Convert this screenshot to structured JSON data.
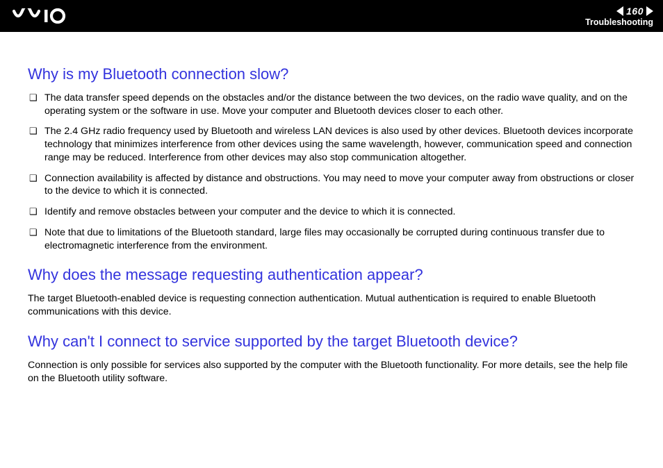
{
  "header": {
    "page_number": "160",
    "section": "Troubleshooting"
  },
  "q1": {
    "title": "Why is my Bluetooth connection slow?",
    "bullets": [
      "The data transfer speed depends on the obstacles and/or the distance between the two devices, on the radio wave quality, and on the operating system or the software in use. Move your computer and Bluetooth devices closer to each other.",
      "The 2.4 GHz radio frequency used by Bluetooth and wireless LAN devices is also used by other devices. Bluetooth devices incorporate technology that minimizes interference from other devices using the same wavelength, however, communication speed and connection range may be reduced. Interference from other devices may also stop communication altogether.",
      "Connection availability is affected by distance and obstructions. You may need to move your computer away from obstructions or closer to the device to which it is connected.",
      "Identify and remove obstacles between your computer and the device to which it is connected.",
      "Note that due to limitations of the Bluetooth standard, large files may occasionally be corrupted during continuous transfer due to electromagnetic interference from the environment."
    ]
  },
  "q2": {
    "title": "Why does the message requesting authentication appear?",
    "body": "The target Bluetooth-enabled device is requesting connection authentication. Mutual authentication is required to enable Bluetooth communications with this device."
  },
  "q3": {
    "title": "Why can't I connect to service supported by the target Bluetooth device?",
    "body": "Connection is only possible for services also supported by the computer with the Bluetooth functionality. For more details, see the help file on the Bluetooth utility software."
  }
}
